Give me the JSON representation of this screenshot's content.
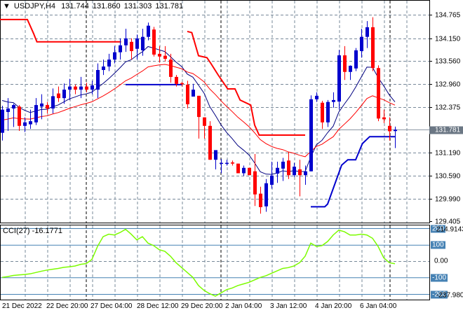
{
  "header": {
    "symbol": "USDJPY,H4",
    "open": "131.744",
    "high": "131.860",
    "low": "131.303",
    "close": "131.781"
  },
  "cci_header": {
    "label": "CCI(27)",
    "value": "-16.1771"
  },
  "price_axis": [
    "134.765",
    "134.150",
    "133.560",
    "132.960",
    "132.375",
    "131.190",
    "130.590",
    "129.990",
    "129.405"
  ],
  "price_axis_values": [
    134.765,
    134.15,
    133.56,
    132.96,
    132.375,
    131.19,
    130.59,
    129.99,
    129.405
  ],
  "current_price": {
    "label": "131.781",
    "value": 131.781
  },
  "cci_axis": {
    "max": "214.9143",
    "max_level": "200",
    "up": "100",
    "zero": "0.00",
    "down": "-100",
    "min": "-237.9803",
    "min_level": "-200"
  },
  "time_axis": [
    "21 Dec 2022",
    "22 Dec 20:00",
    "27 Dec 04:00",
    "28 Dec 12:00",
    "29 Dec 20:00",
    "2 Jan 04:00",
    "3 Jan 12:00",
    "4 Jan 20:00",
    "6 Jan 04:00"
  ],
  "colors": {
    "bull": "#0000cd",
    "bear": "#ff0000",
    "fast_ma": "#000080",
    "slow_ma": "#ff0000",
    "cci": "#7cfc00",
    "grid": "#778899",
    "level": "#4682b4"
  },
  "chart_data": {
    "type": "candlestick",
    "symbol": "USDJPY",
    "timeframe": "H4",
    "ylim": [
      129.405,
      134.765
    ],
    "ohlc": [
      [
        131.7,
        132.4,
        131.5,
        132.3
      ],
      [
        132.24,
        132.6,
        131.75,
        132.33
      ],
      [
        132.33,
        132.45,
        131.85,
        132.42
      ],
      [
        132.38,
        132.42,
        131.75,
        131.88
      ],
      [
        131.88,
        132.1,
        131.72,
        131.97
      ],
      [
        131.92,
        132.3,
        131.8,
        132.0
      ],
      [
        131.97,
        132.6,
        131.9,
        132.42
      ],
      [
        132.38,
        132.7,
        132.05,
        132.46
      ],
      [
        132.42,
        132.5,
        132.2,
        132.33
      ],
      [
        132.33,
        132.85,
        132.2,
        132.65
      ],
      [
        132.72,
        132.9,
        132.5,
        132.6
      ],
      [
        132.6,
        132.98,
        132.45,
        132.82
      ],
      [
        132.82,
        133.1,
        132.55,
        132.9
      ],
      [
        132.9,
        132.95,
        132.7,
        132.82
      ],
      [
        132.82,
        133.15,
        132.6,
        132.9
      ],
      [
        132.9,
        133.0,
        132.75,
        132.82
      ],
      [
        132.82,
        133.05,
        132.7,
        132.93
      ],
      [
        132.82,
        133.5,
        132.6,
        133.33
      ],
      [
        133.33,
        133.6,
        133.2,
        133.42
      ],
      [
        133.42,
        133.75,
        133.3,
        133.6
      ],
      [
        133.6,
        133.95,
        133.5,
        133.79
      ],
      [
        133.79,
        134.15,
        133.6,
        133.97
      ],
      [
        133.97,
        134.4,
        133.8,
        134.15
      ],
      [
        134.06,
        134.15,
        133.6,
        133.82
      ],
      [
        133.88,
        134.25,
        133.6,
        134.15
      ],
      [
        133.84,
        134.4,
        133.7,
        134.19
      ],
      [
        134.19,
        134.56,
        134.1,
        134.48
      ],
      [
        134.38,
        134.45,
        133.68,
        133.73
      ],
      [
        133.75,
        133.95,
        133.52,
        133.68
      ],
      [
        133.7,
        133.95,
        133.55,
        133.62
      ],
      [
        133.6,
        133.75,
        133.0,
        133.15
      ],
      [
        133.15,
        133.2,
        132.9,
        132.97
      ],
      [
        132.99,
        133.02,
        132.9,
        132.96
      ],
      [
        132.95,
        133.05,
        132.33,
        132.44
      ],
      [
        132.64,
        132.97,
        132.64,
        132.82
      ],
      [
        132.66,
        132.66,
        131.55,
        132.11
      ],
      [
        132.1,
        132.1,
        131.55,
        131.88
      ],
      [
        131.88,
        132.0,
        131.0,
        131.0
      ],
      [
        131.0,
        131.25,
        130.75,
        131.25
      ],
      [
        130.9,
        131.02,
        130.65,
        130.92
      ],
      [
        130.92,
        131.0,
        130.85,
        130.92
      ],
      [
        130.93,
        130.98,
        130.85,
        130.9
      ],
      [
        130.9,
        130.9,
        130.65,
        130.65
      ],
      [
        130.65,
        130.85,
        130.58,
        130.79
      ],
      [
        130.79,
        130.79,
        130.6,
        130.6
      ],
      [
        130.7,
        131.15,
        129.8,
        130.1
      ],
      [
        130.12,
        130.3,
        129.6,
        129.77
      ],
      [
        129.79,
        130.5,
        129.65,
        130.39
      ],
      [
        130.35,
        130.95,
        130.25,
        130.59
      ],
      [
        130.64,
        130.95,
        130.4,
        130.79
      ],
      [
        130.77,
        131.05,
        130.45,
        130.95
      ],
      [
        130.98,
        131.2,
        130.5,
        130.6
      ],
      [
        130.6,
        130.92,
        130.55,
        130.82
      ],
      [
        130.75,
        131.0,
        130.05,
        130.6
      ],
      [
        130.6,
        130.85,
        130.35,
        130.7
      ],
      [
        130.7,
        132.67,
        130.7,
        132.57
      ],
      [
        132.57,
        132.75,
        132.5,
        132.66
      ],
      [
        132.48,
        132.53,
        131.8,
        131.97
      ],
      [
        131.97,
        132.55,
        131.85,
        132.5
      ],
      [
        132.5,
        132.75,
        132.35,
        132.55
      ],
      [
        132.51,
        133.85,
        132.3,
        133.71
      ],
      [
        133.71,
        133.95,
        133.07,
        133.28
      ],
      [
        133.28,
        133.45,
        133.07,
        133.44
      ],
      [
        133.37,
        133.9,
        133.3,
        133.84
      ],
      [
        133.82,
        134.4,
        133.65,
        134.19
      ],
      [
        134.19,
        134.6,
        133.9,
        134.44
      ],
      [
        134.44,
        134.7,
        133.3,
        133.38
      ],
      [
        133.38,
        133.45,
        132.0,
        132.07
      ],
      [
        132.1,
        132.3,
        131.95,
        132.05
      ],
      [
        131.88,
        132.1,
        131.5,
        131.74
      ],
      [
        131.744,
        131.86,
        131.303,
        131.781
      ]
    ],
    "resistance_steps": [
      [
        [
          -0.4,
          134.64
        ],
        [
          4.5,
          134.64
        ],
        [
          5.6,
          134.28
        ],
        [
          6.2,
          134.06
        ],
        [
          21.2,
          134.06
        ]
      ],
      [
        [
          33,
          134.33
        ],
        [
          33.8,
          134.3
        ],
        [
          35,
          133.7
        ],
        [
          36.5,
          133.65
        ],
        [
          37.2,
          133.5
        ],
        [
          38.5,
          133.2
        ],
        [
          40.2,
          132.84
        ],
        [
          41.5,
          132.84
        ],
        [
          42.4,
          132.55
        ],
        [
          44.3,
          132.42
        ],
        [
          45,
          131.9
        ],
        [
          45.8,
          131.64
        ],
        [
          54,
          131.64
        ]
      ]
    ],
    "support_steps": [
      [
        [
          22,
          132.95
        ],
        [
          32,
          132.95
        ]
      ],
      [
        [
          55,
          129.78
        ],
        [
          57.5,
          129.78
        ],
        [
          58,
          129.85
        ],
        [
          60.5,
          130.86
        ],
        [
          61.6,
          131.0
        ],
        [
          63,
          131.0
        ],
        [
          64.2,
          131.42
        ],
        [
          65.5,
          131.6
        ],
        [
          70,
          131.6
        ]
      ]
    ],
    "cci": {
      "period": 27,
      "ylim": [
        -237.9803,
        214.9143
      ],
      "levels": [
        100,
        -100
      ],
      "values": [
        -100,
        -95,
        -88,
        -85,
        -82,
        -78,
        -70,
        -62,
        -55,
        -50,
        -45,
        -38,
        -35,
        -30,
        -20,
        -15,
        10,
        90,
        150,
        165,
        160,
        175,
        195,
        165,
        130,
        150,
        110,
        95,
        70,
        60,
        30,
        -10,
        -40,
        -70,
        -100,
        -150,
        -180,
        -200,
        -215,
        -195,
        -175,
        -165,
        -150,
        -140,
        -130,
        -115,
        -100,
        -90,
        -75,
        -60,
        -45,
        -40,
        -30,
        -10,
        30,
        110,
        90,
        95,
        120,
        160,
        190,
        180,
        160,
        160,
        165,
        160,
        140,
        90,
        20,
        -10,
        -16.18
      ]
    }
  }
}
